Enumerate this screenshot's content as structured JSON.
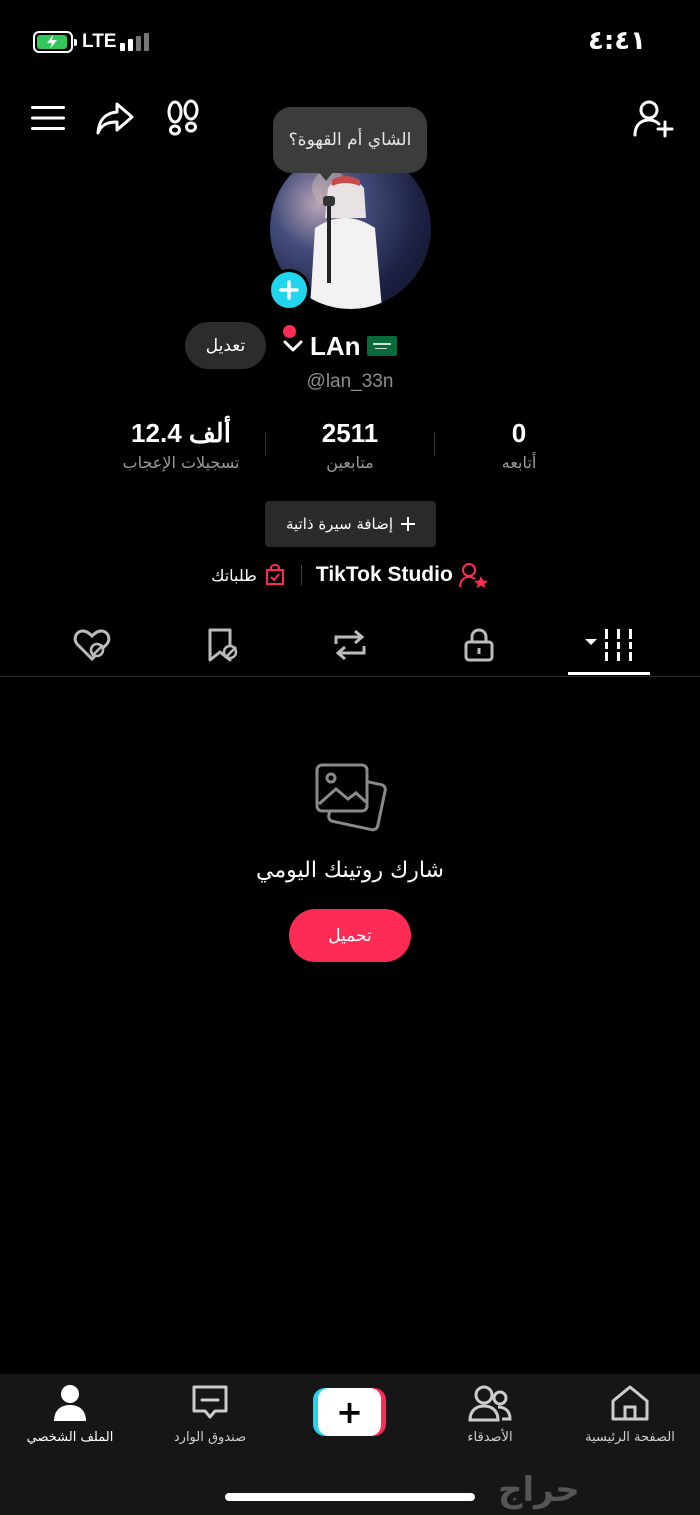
{
  "status_bar": {
    "network": "LTE",
    "time": "٤:٤١"
  },
  "header": {
    "icons": [
      "menu-icon",
      "share-icon",
      "footprints-icon",
      "add-friend-icon"
    ],
    "bubble_text": "الشاي أم القهوة؟"
  },
  "profile": {
    "edit_label": "تعديل",
    "name": "LAn",
    "handle": "@lan_33n",
    "stats": [
      {
        "value": "12.4 ألف",
        "label": "تسجيلات الإعجاب"
      },
      {
        "value": "2511",
        "label": "متابعين"
      },
      {
        "value": "0",
        "label": "أتابعه"
      }
    ],
    "add_bio_label": "إضافة سيرة ذاتية",
    "studio_label": "TikTok Studio",
    "orders_label": "طلباتك"
  },
  "tabs": [
    "liked-hidden-icon",
    "favorites-hidden-icon",
    "repost-icon",
    "lock-icon",
    "grid-icon"
  ],
  "empty_state": {
    "title": "شارك روتينك اليومي",
    "button": "تحميل"
  },
  "bottom_nav": [
    {
      "label": "الملف الشخصي",
      "icon": "profile-icon"
    },
    {
      "label": "صندوق الوارد",
      "icon": "inbox-icon"
    },
    {
      "label": "",
      "icon": "create-icon"
    },
    {
      "label": "الأصدقاء",
      "icon": "friends-icon"
    },
    {
      "label": "الصفحة الرئيسية",
      "icon": "home-icon"
    }
  ],
  "watermark": "حراج",
  "colors": {
    "accent": "#fe2c55",
    "cyan": "#20d5ec",
    "battery": "#31c75a"
  }
}
